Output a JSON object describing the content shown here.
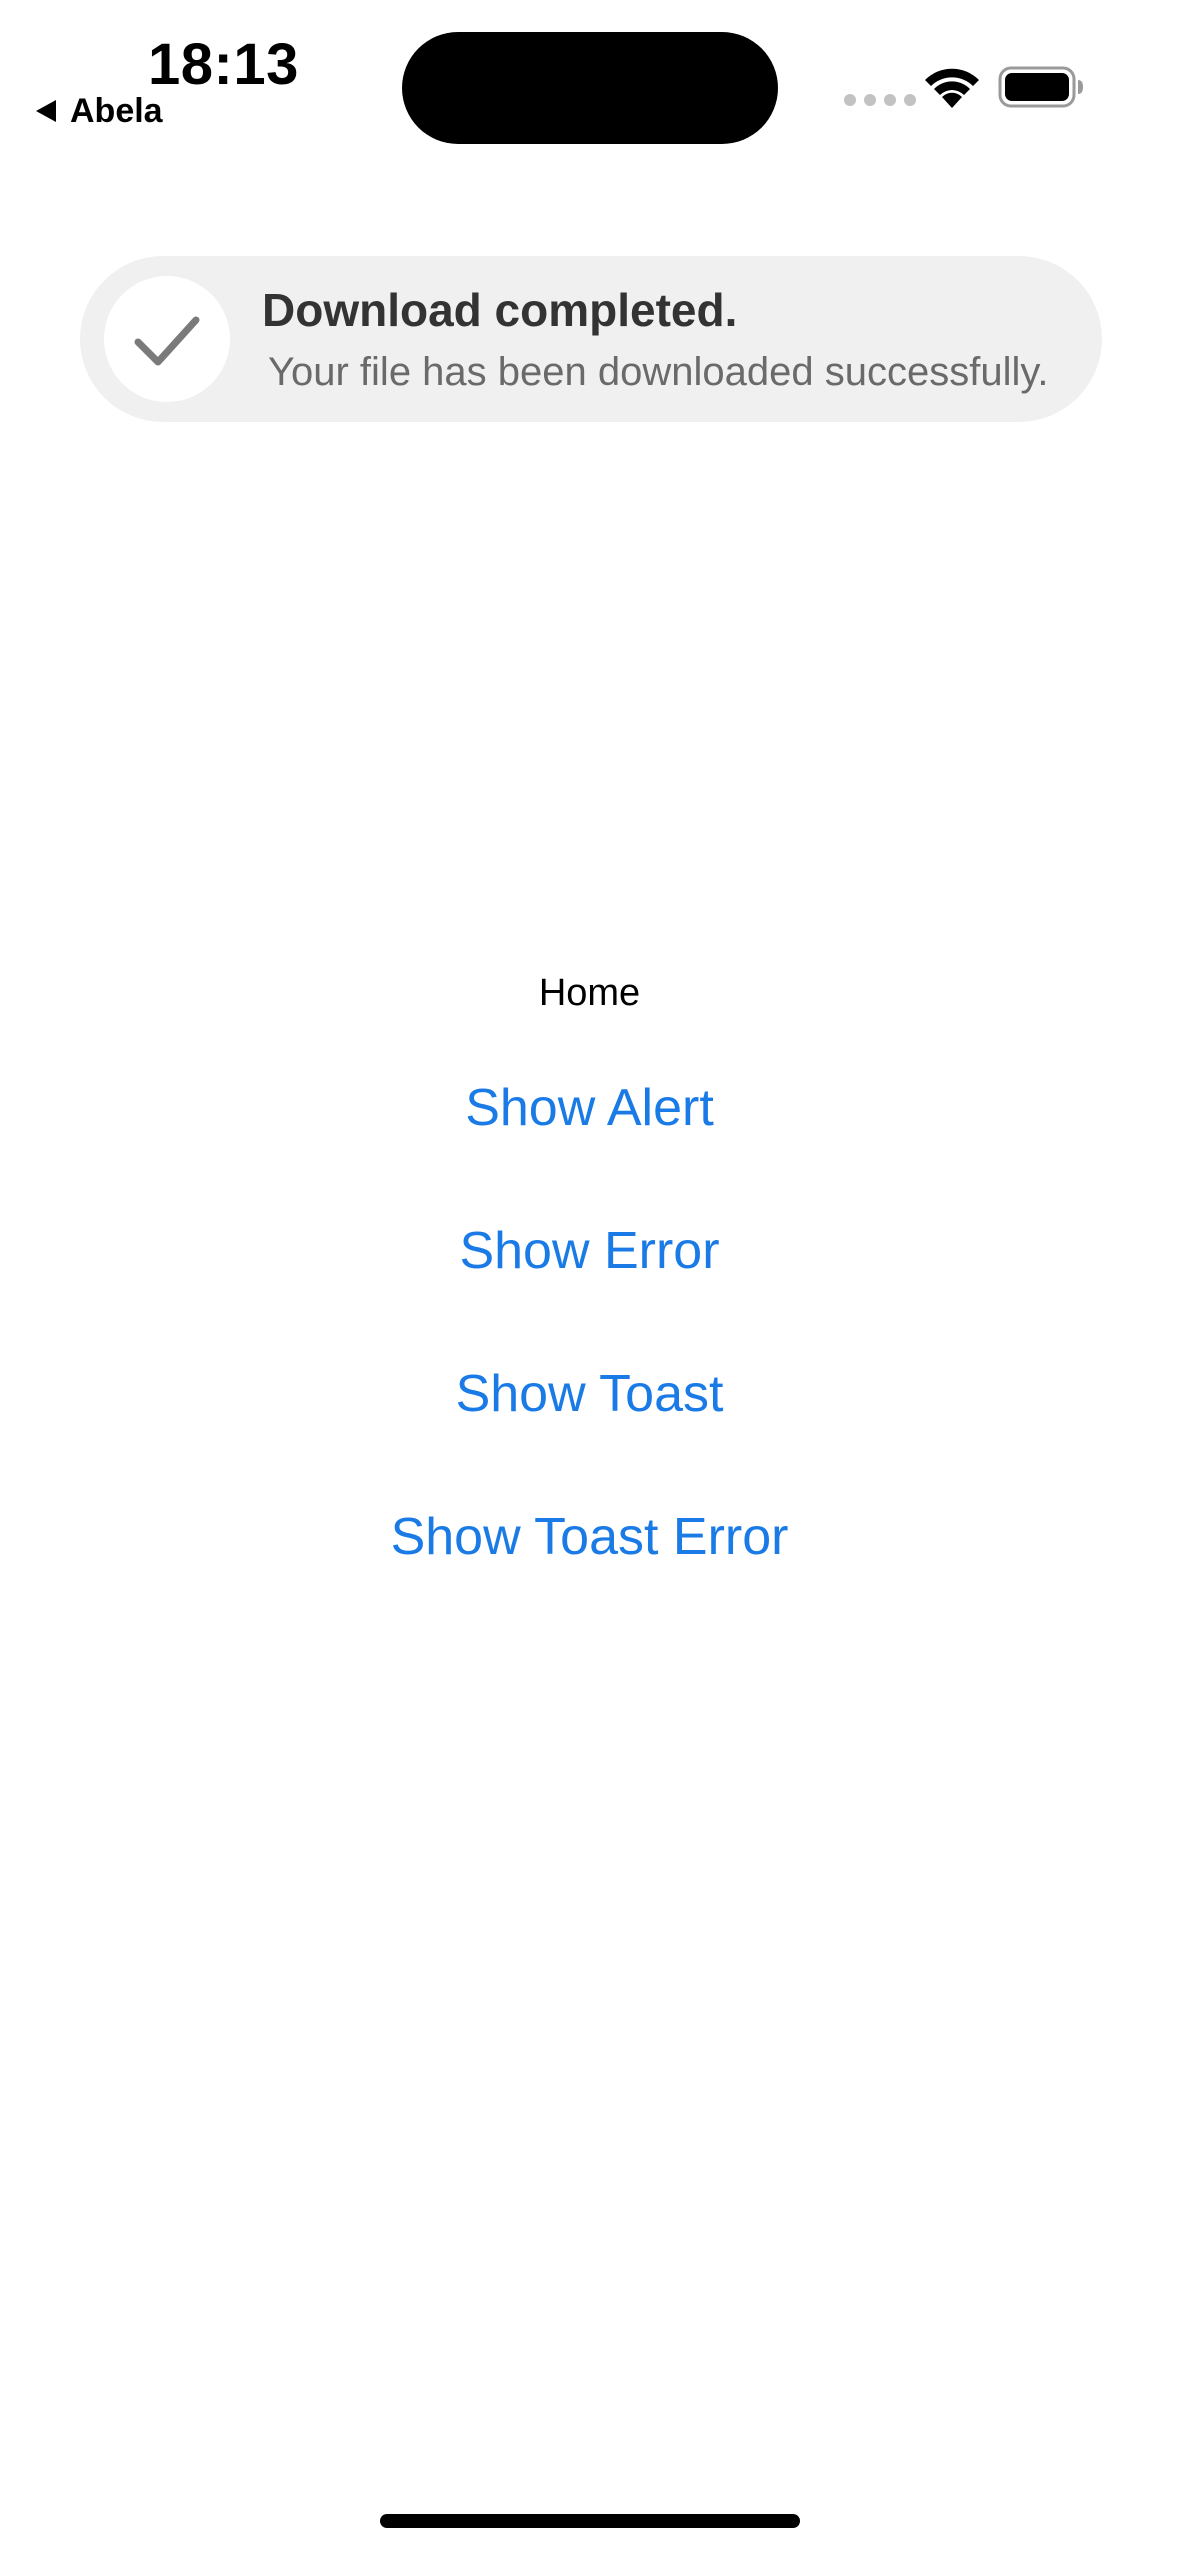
{
  "status_bar": {
    "time": "18:13",
    "back_app": "Abela"
  },
  "toast": {
    "icon": "checkmark-icon",
    "title": "Download completed.",
    "message": "Your file has been downloaded successfully."
  },
  "main": {
    "title": "Home",
    "buttons": [
      {
        "label": "Show Alert"
      },
      {
        "label": "Show Error"
      },
      {
        "label": "Show Toast"
      },
      {
        "label": "Show Toast Error"
      }
    ]
  },
  "colors": {
    "accent": "#1a7be6",
    "toast_background": "#f0f0f0",
    "toast_title": "#333333",
    "toast_message": "#6a6a6a"
  }
}
